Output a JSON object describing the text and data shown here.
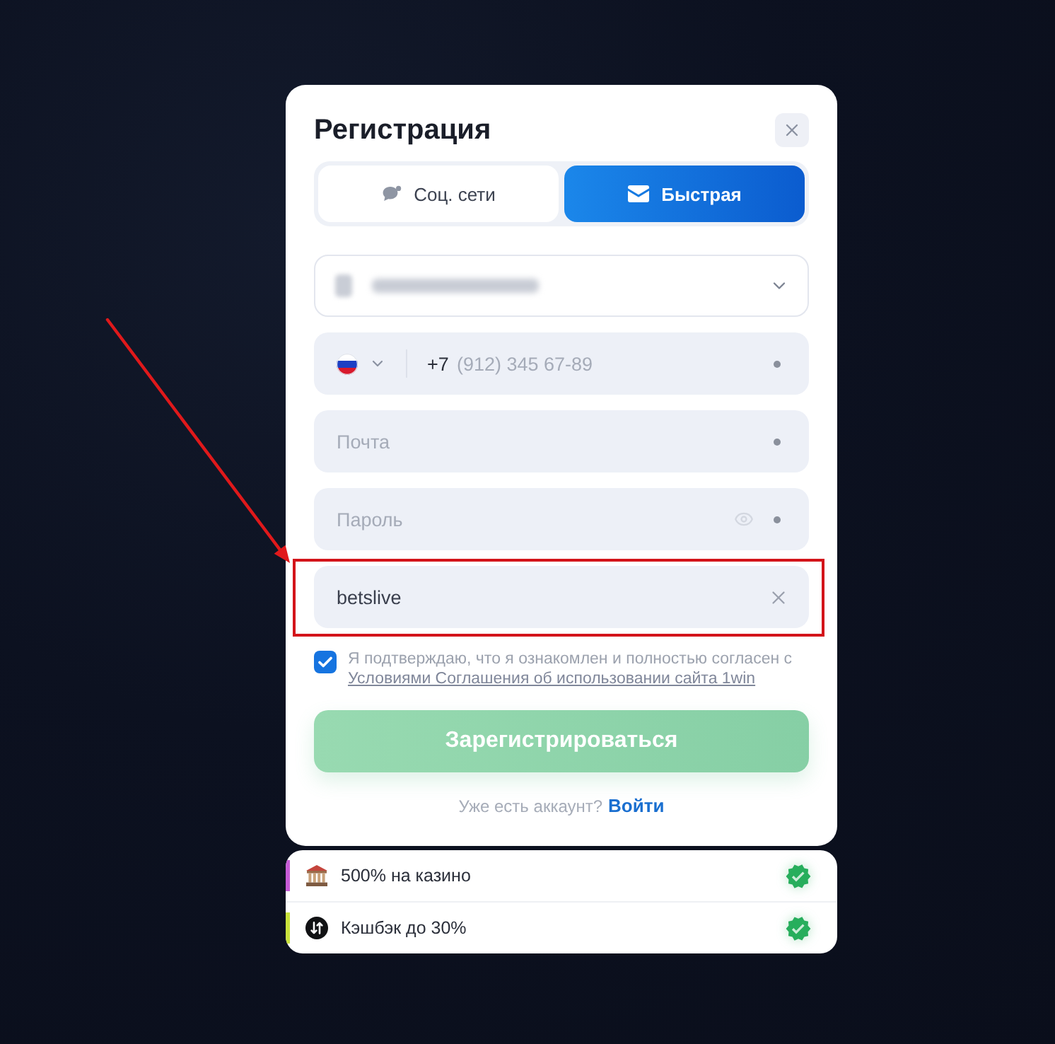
{
  "modal": {
    "title": "Регистрация",
    "tabs": [
      {
        "kind": "social",
        "label": "Соц. сети",
        "selected": false
      },
      {
        "kind": "email",
        "label": "Быстрая",
        "selected": true
      }
    ],
    "fields": [
      {
        "kind": "select",
        "required": false,
        "highlighted": false
      },
      {
        "kind": "phone",
        "prefix": "+7",
        "placeholder": "(912) 345 67-89",
        "required": true,
        "highlighted": false
      },
      {
        "kind": "email",
        "placeholder": "Почта",
        "required": true,
        "highlighted": false
      },
      {
        "kind": "password",
        "placeholder": "Пароль",
        "required": true,
        "highlighted": false
      },
      {
        "kind": "promo",
        "value": "betslive",
        "required": false,
        "highlighted": true
      }
    ],
    "agreement": {
      "checked": true,
      "text": "Я подтверждаю, что я ознакомлен и полностью согласен с",
      "link": "Условиями Соглашения об использовании сайта 1win"
    },
    "submit": {
      "label": "Зарегистрироваться",
      "disabled": true
    },
    "login_prompt": {
      "text": "Уже есть аккаунт?",
      "link": "Войти"
    }
  },
  "bonuses": [
    {
      "kind": "casino",
      "label": "500% на казино",
      "color": "#c65bd6",
      "checked": true
    },
    {
      "kind": "cashback",
      "label": "Кэшбэк до 30%",
      "color": "#c9e23c",
      "checked": true
    }
  ]
}
